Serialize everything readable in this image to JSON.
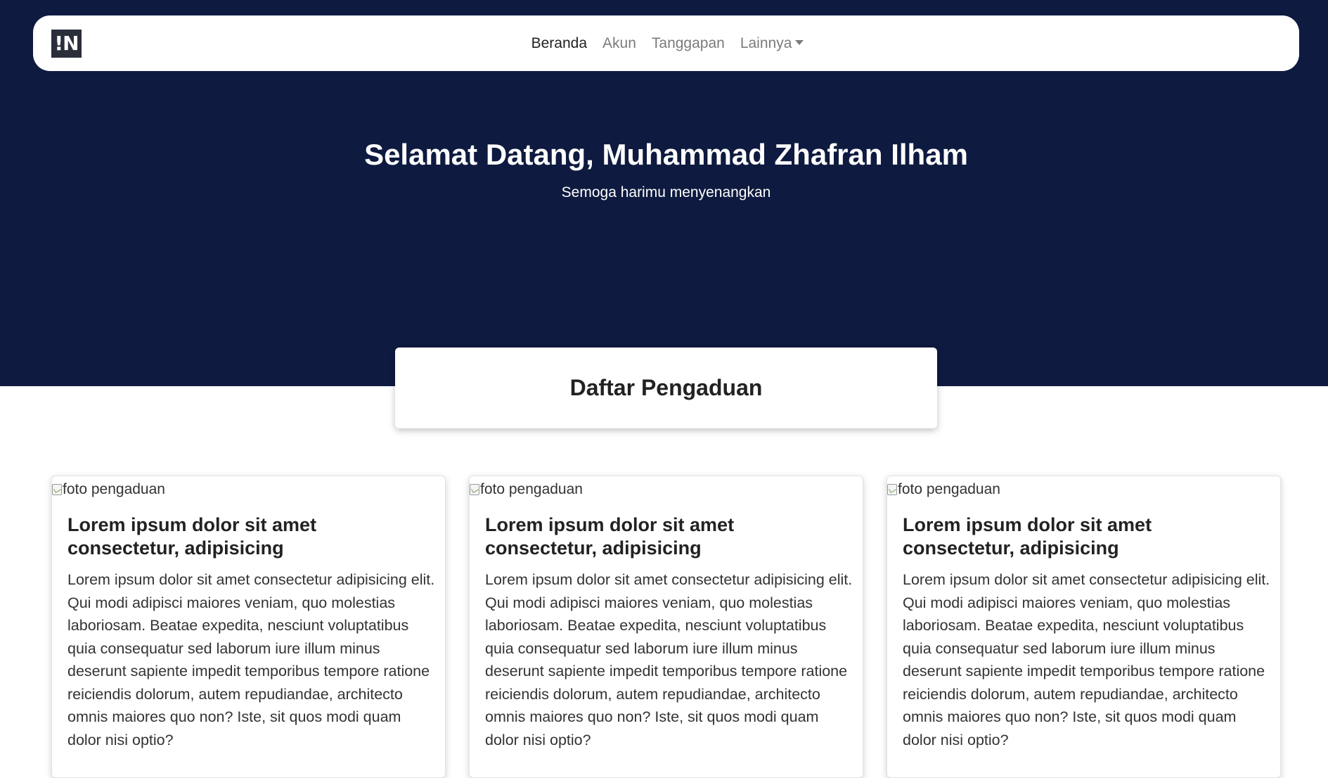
{
  "navbar": {
    "brand": "!N",
    "items": [
      {
        "label": "Beranda",
        "active": true
      },
      {
        "label": "Akun",
        "active": false
      },
      {
        "label": "Tanggapan",
        "active": false
      },
      {
        "label": "Lainnya",
        "active": false,
        "dropdown": true
      }
    ]
  },
  "hero": {
    "title": "Selamat Datang, Muhammad Zhafran Ilham",
    "subtitle": "Semoga harimu menyenangkan"
  },
  "section": {
    "title": "Daftar Pengaduan"
  },
  "cards": [
    {
      "image_alt": "foto pengaduan",
      "title": "Lorem ipsum dolor sit amet consectetur, adipisicing",
      "body": "Lorem ipsum dolor sit amet consectetur adipisicing elit. Qui modi adipisci maiores veniam, quo molestias laboriosam. Beatae expedita, nesciunt voluptatibus quia consequatur sed laborum iure illum minus deserunt sapiente impedit temporibus tempore ratione reiciendis dolorum, autem repudiandae, architecto omnis maiores quo non? Iste, sit quos modi quam dolor nisi optio?"
    },
    {
      "image_alt": "foto pengaduan",
      "title": "Lorem ipsum dolor sit amet consectetur, adipisicing",
      "body": "Lorem ipsum dolor sit amet consectetur adipisicing elit. Qui modi adipisci maiores veniam, quo molestias laboriosam. Beatae expedita, nesciunt voluptatibus quia consequatur sed laborum iure illum minus deserunt sapiente impedit temporibus tempore ratione reiciendis dolorum, autem repudiandae, architecto omnis maiores quo non? Iste, sit quos modi quam dolor nisi optio?"
    },
    {
      "image_alt": "foto pengaduan",
      "title": "Lorem ipsum dolor sit amet consectetur, adipisicing",
      "body": "Lorem ipsum dolor sit amet consectetur adipisicing elit. Qui modi adipisci maiores veniam, quo molestias laboriosam. Beatae expedita, nesciunt voluptatibus quia consequatur sed laborum iure illum minus deserunt sapiente impedit temporibus tempore ratione reiciendis dolorum, autem repudiandae, architecto omnis maiores quo non? Iste, sit quos modi quam dolor nisi optio?"
    }
  ],
  "colors": {
    "hero_background": "#0e1a3f",
    "brand_background": "#2b2e3b",
    "nav_active": "#222222",
    "nav_inactive": "#7b7b7b"
  }
}
